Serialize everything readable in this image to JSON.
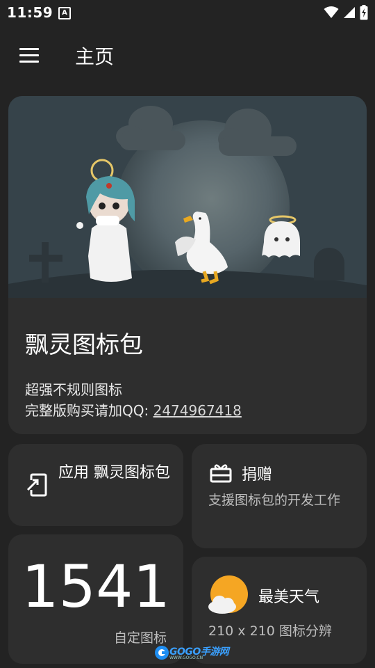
{
  "status_bar": {
    "time": "11:59",
    "notification_badge": "A",
    "icons": [
      "wifi-icon",
      "signal-icon",
      "battery-charging-icon"
    ]
  },
  "app_bar": {
    "title": "主页",
    "menu_icon": "hamburger-menu-icon"
  },
  "hero": {
    "title": "飘灵图标包",
    "line1": "超强不规则图标",
    "line2_prefix": "完整版购买请加QQ: ",
    "qq_link": "2474967418",
    "illustration": "ghost-graveyard-illustration"
  },
  "apply_card": {
    "icon": "apply-icon",
    "label": "应用 飘灵图标包"
  },
  "donate_card": {
    "icon": "gift-icon",
    "title": "捐赠",
    "description": "支援图标包的开发工作"
  },
  "count_card": {
    "count": "1541",
    "label": "自定图标"
  },
  "weather_card": {
    "icon": "sun-cloud-icon",
    "title": "最美天气",
    "description": "210 x 210 图标分辨"
  },
  "watermark": {
    "text": "GOGO手游网",
    "sub": "WWW.GOGO.CN"
  },
  "colors": {
    "background": "#232323",
    "card": "#2e2e2e",
    "secondary_text": "#bdbdbd",
    "weather_sun": "#f5a623"
  }
}
